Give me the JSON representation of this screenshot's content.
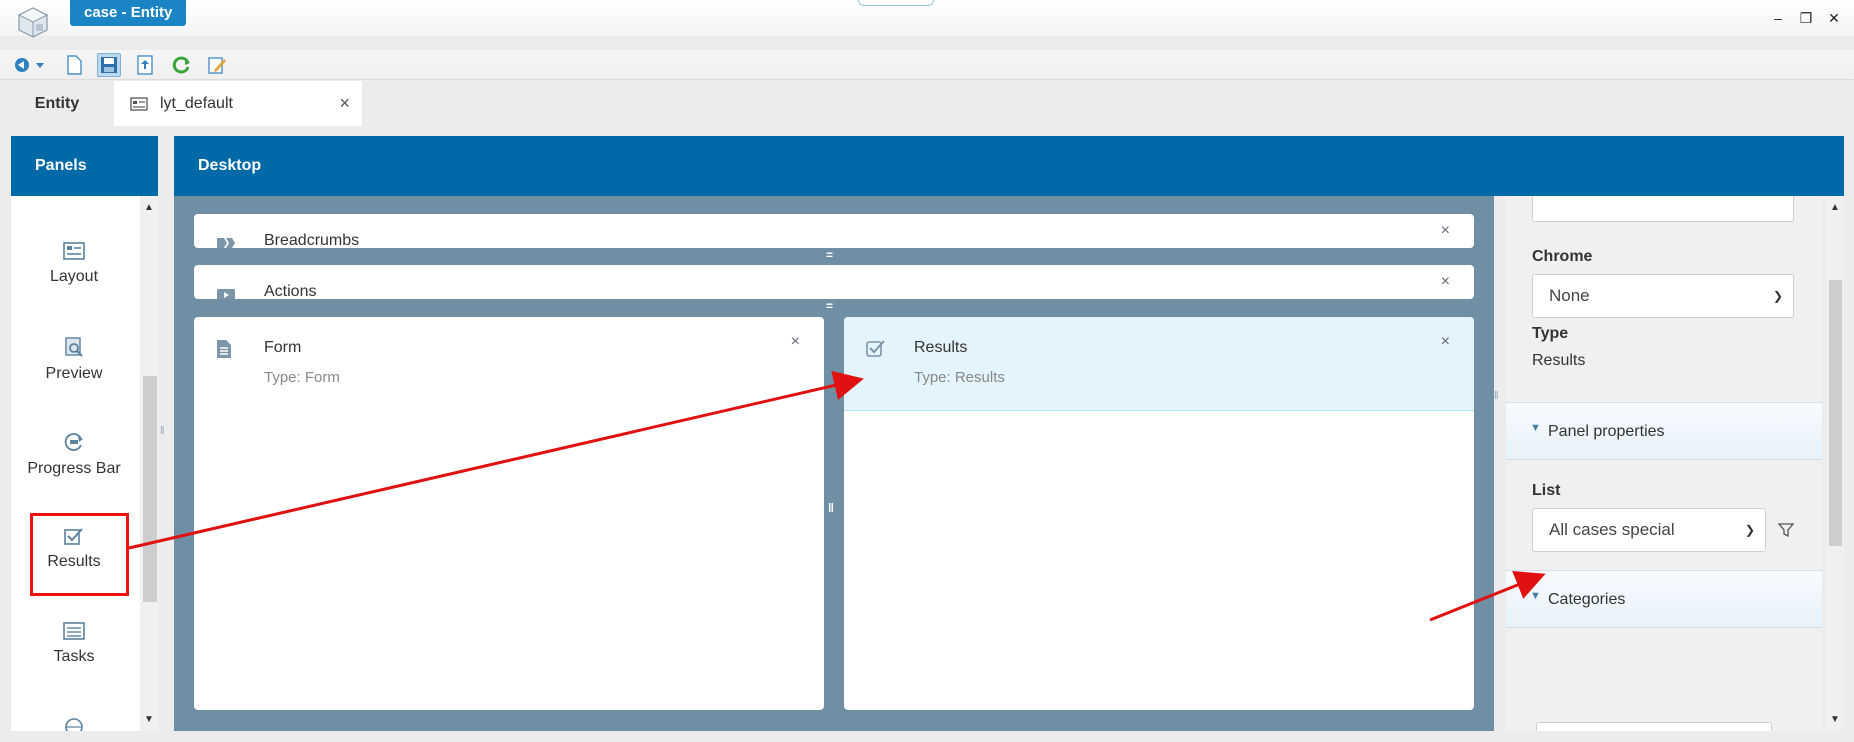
{
  "window": {
    "title": "case - Entity",
    "minimize_glyph": "–",
    "restore_glyph": "❐",
    "close_glyph": "✕"
  },
  "toolbar": {
    "icons": [
      "navigate-icon",
      "new-document-icon",
      "save-icon",
      "export-icon",
      "refresh-icon",
      "edit-icon"
    ]
  },
  "tabs": {
    "entity": "Entity",
    "layout": "lyt_default",
    "close_glyph": "×"
  },
  "panels": {
    "header": "Panels",
    "items": [
      {
        "label": "Layout",
        "icon": "layout-icon"
      },
      {
        "label": "Preview",
        "icon": "preview-icon"
      },
      {
        "label": "Progress Bar",
        "icon": "progress-bar-icon"
      },
      {
        "label": "Results",
        "icon": "results-icon"
      },
      {
        "label": "Tasks",
        "icon": "tasks-icon"
      }
    ]
  },
  "desktop": {
    "header": "Desktop",
    "bars": [
      {
        "label": "Breadcrumbs",
        "icon": "breadcrumbs-icon"
      },
      {
        "label": "Actions",
        "icon": "actions-icon"
      }
    ],
    "cards": [
      {
        "title": "Form",
        "subtitle": "Type: Form",
        "icon": "form-icon",
        "selected": false
      },
      {
        "title": "Results",
        "subtitle": "Type: Results",
        "icon": "results-icon",
        "selected": true
      }
    ],
    "close_glyph": "×"
  },
  "properties": {
    "chrome_label": "Chrome",
    "chrome_value": "None",
    "type_label": "Type",
    "type_value": "Results",
    "panel_properties": "Panel properties",
    "list_label": "List",
    "list_value": "All cases special",
    "categories": "Categories"
  },
  "colors": {
    "header_blue": "#0069a8",
    "title_tab": "#1a84c4",
    "canvas": "#6f8fa5",
    "selected_card": "#e4f4fd",
    "annotation_red": "#e11111"
  }
}
